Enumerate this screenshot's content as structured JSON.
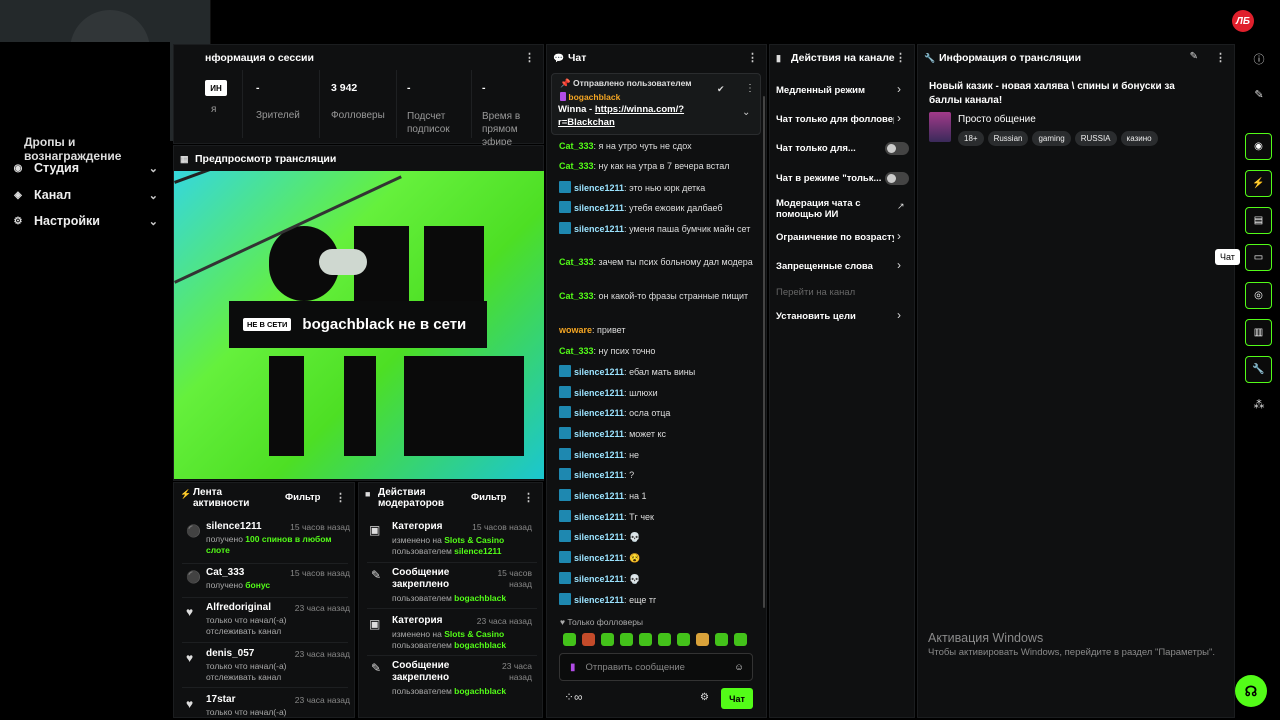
{
  "header": {
    "logo_text": "ЛБ"
  },
  "sidenav": {
    "drops": "Дропы и вознаграждение",
    "items": [
      {
        "label": "Студия",
        "icon": "studio-icon"
      },
      {
        "label": "Канал",
        "icon": "channel-icon"
      },
      {
        "label": "Настройки",
        "icon": "gear-icon"
      }
    ]
  },
  "session": {
    "title": "нформация о сессии",
    "badge": "ИН",
    "badge_sub": "я",
    "stats": [
      {
        "value": "-",
        "label": "Зрителей"
      },
      {
        "value": "3 942",
        "label": "Фолловеры"
      },
      {
        "value": "-",
        "label": "Подсчет подписок"
      },
      {
        "value": "-",
        "label": "Время в прямом эфире"
      }
    ]
  },
  "preview": {
    "title": "Предпросмотр трансляции",
    "badge": "НЕ В СЕТИ",
    "status": "bogachblack не в сети"
  },
  "activity": {
    "title": "Лента активности",
    "filter": "Фильтр",
    "items": [
      {
        "name": "silence1211",
        "time": "15 часов назад",
        "pre": "получено ",
        "hl": "100 спинов в любом слоте",
        "post": ""
      },
      {
        "name": "Cat_333",
        "time": "15 часов назад",
        "pre": "получено ",
        "hl": "бонус",
        "post": ""
      },
      {
        "name": "Alfredoriginal",
        "time": "23 часа назад",
        "pre": "только что начал(-а) отслеживать канал",
        "hl": "",
        "post": ""
      },
      {
        "name": "denis_057",
        "time": "23 часа назад",
        "pre": "только что начал(-а) отслеживать канал",
        "hl": "",
        "post": ""
      },
      {
        "name": "17star",
        "time": "23 часа назад",
        "pre": "только что начал(-а) отслеживать канал",
        "hl": "",
        "post": ""
      }
    ]
  },
  "modactions": {
    "title": "Действия модераторов",
    "filter": "Фильтр",
    "items": [
      {
        "title": "Категория",
        "time": "15 часов назад",
        "line1": "изменено на ",
        "line1hl": "Slots & Casino",
        "line2": "пользователем ",
        "line2hl": "silence1211"
      },
      {
        "title": "Сообщение закреплено",
        "time": "15 часов назад",
        "line1": "",
        "line1hl": "",
        "line2": "пользователем ",
        "line2hl": "bogachblack"
      },
      {
        "title": "Категория",
        "time": "23 часа назад",
        "line1": "изменено на ",
        "line1hl": "Slots & Casino",
        "line2": "пользователем ",
        "line2hl": "bogachblack"
      },
      {
        "title": "Сообщение закреплено",
        "time": "23 часа назад",
        "line1": "",
        "line1hl": "",
        "line2": "пользователем ",
        "line2hl": "bogachblack"
      }
    ]
  },
  "chat": {
    "title": "Чат",
    "pinned": {
      "label": "Отправлено пользователем",
      "user": "bogachblack",
      "text_pre": "Winna - ",
      "link": "https://winna.com/?r=Blackchan"
    },
    "messages": [
      {
        "user": "Cat_333",
        "kind": "c",
        "text": "я на утро чуть не сдох"
      },
      {
        "user": "Cat_333",
        "kind": "c",
        "text": "ну как на утра в 7 вечера встал"
      },
      {
        "user": "silence1211",
        "kind": "s",
        "text": "это нью юрк детка"
      },
      {
        "user": "silence1211",
        "kind": "s",
        "text": "утебя ежовик далбаеб"
      },
      {
        "user": "silence1211",
        "kind": "s",
        "text": "уменя паша бумчик майн сет"
      },
      {
        "user": "Cat_333",
        "kind": "c",
        "text": "зачем ты псих больному дал модера"
      },
      {
        "user": "Cat_333",
        "kind": "c",
        "text": "он какой-то фразы странные пищит"
      },
      {
        "user": "woware",
        "kind": "o",
        "text": "привет"
      },
      {
        "user": "Cat_333",
        "kind": "c",
        "text": "ну псих точно"
      },
      {
        "user": "silence1211",
        "kind": "s",
        "text": "ебал мать вины"
      },
      {
        "user": "silence1211",
        "kind": "s",
        "text": "шлюхи"
      },
      {
        "user": "silence1211",
        "kind": "s",
        "text": "осла отца"
      },
      {
        "user": "silence1211",
        "kind": "s",
        "text": "может кс"
      },
      {
        "user": "silence1211",
        "kind": "s",
        "text": "не"
      },
      {
        "user": "silence1211",
        "kind": "s",
        "text": "?"
      },
      {
        "user": "silence1211",
        "kind": "s",
        "text": "на 1"
      },
      {
        "user": "silence1211",
        "kind": "s",
        "text": "Тг чек"
      },
      {
        "user": "silence1211",
        "kind": "s",
        "text": "💀"
      },
      {
        "user": "silence1211",
        "kind": "s",
        "text": "😵"
      },
      {
        "user": "silence1211",
        "kind": "s",
        "text": "💀"
      },
      {
        "user": "silence1211",
        "kind": "s",
        "text": "еще тг"
      }
    ],
    "followers_only": "Только фолловеры",
    "input_placeholder": "Отправить сообщение",
    "send": "Чат"
  },
  "channel_actions": {
    "title": "Действия на канале",
    "items": [
      {
        "label": "Медленный режим",
        "ctrl": "chev"
      },
      {
        "label": "Чат только для фолловеров",
        "ctrl": "chev"
      },
      {
        "label": "Чат только для...",
        "ctrl": "toggle"
      },
      {
        "label": "Чат в режиме \"тольк...",
        "ctrl": "toggle"
      },
      {
        "label": "Модерация чата с помощью ИИ",
        "ctrl": "ext"
      },
      {
        "label": "Ограничение по возрасту",
        "ctrl": "chev"
      },
      {
        "label": "Запрещенные слова",
        "ctrl": "chev"
      },
      {
        "label": "Перейти на канал",
        "ctrl": "none"
      },
      {
        "label": "Установить цели",
        "ctrl": "chev"
      }
    ]
  },
  "stream_info": {
    "title": "Информация о трансляции",
    "stream_title": "Новый казик - новая халява \\ спины и бонуски за баллы канала!",
    "category": "Просто общение",
    "tags": [
      "18+",
      "Russian",
      "gaming",
      "RUSSIA",
      "казино"
    ]
  },
  "rail": {
    "tooltip": "Чат"
  },
  "windows": {
    "title": "Активация Windows",
    "sub": "Чтобы активировать Windows, перейдите в раздел \"Параметры\"."
  },
  "colors": {
    "accent": "#53fc18",
    "bg": "#0f1011"
  }
}
